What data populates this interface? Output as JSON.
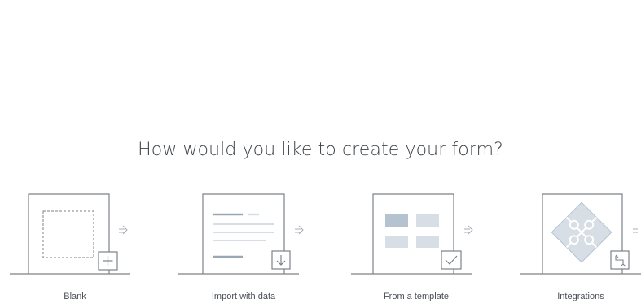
{
  "heading": "How would you like to create your form?",
  "options": [
    {
      "label": "Blank",
      "icon": "plus-icon"
    },
    {
      "label": "Import with data",
      "icon": "download-icon"
    },
    {
      "label": "From a template",
      "icon": "checkmark-icon"
    },
    {
      "label": "Integrations",
      "icon": "sync-icon"
    }
  ],
  "colors": {
    "line": "#7d8288",
    "accent_fill": "#b5c3d1",
    "light_fill": "#d7dee6",
    "text_lines": "#9aa7b5"
  }
}
